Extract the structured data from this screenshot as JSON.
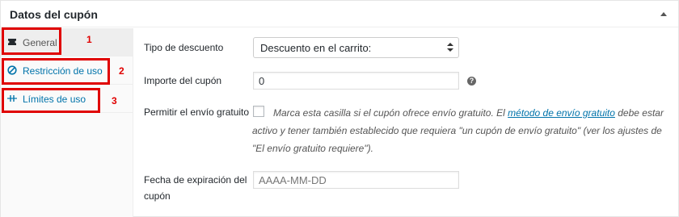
{
  "panel": {
    "title": "Datos del cupón"
  },
  "tabs": [
    {
      "label": "General",
      "icon": "ticket-icon",
      "annotation": "1"
    },
    {
      "label": "Restricción de uso",
      "icon": "restriction-icon",
      "annotation": "2"
    },
    {
      "label": "Límites de uso",
      "icon": "limits-icon",
      "annotation": "3"
    }
  ],
  "form": {
    "discount_type": {
      "label": "Tipo de descuento",
      "value": "Descuento en el carrito:"
    },
    "amount": {
      "label": "Importe del cupón",
      "value": "0",
      "help": "?"
    },
    "free_shipping": {
      "label": "Permitir el envío gratuito",
      "desc_before": "Marca esta casilla si el cupón ofrece envío gratuito. El ",
      "link": "método de envío gratuito",
      "desc_after": " debe estar activo y tener también establecido que requiera \"un cupón de envío gratuito\" (ver los ajustes de \"El envío gratuito requiere\")."
    },
    "expiry": {
      "label": "Fecha de expiración del cupón",
      "placeholder": "AAAA-MM-DD"
    }
  },
  "colors": {
    "annotation_red": "#e00000",
    "link_blue": "#0073aa"
  }
}
